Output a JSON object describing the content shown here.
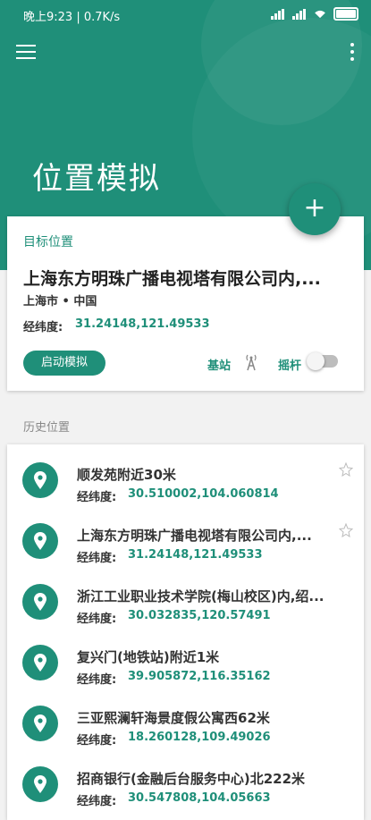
{
  "status_bar": {
    "time": "晚上9:23 | 0.7K/s"
  },
  "header": {
    "title": "位置模拟",
    "fab_label": "+"
  },
  "target": {
    "label": "目标位置",
    "name": "上海东方明珠广播电视塔有限公司内,...",
    "city": "上海市 • 中国",
    "coord_label": "经纬度:",
    "coord_value": "31.24148,121.49533",
    "start_button": "启动模拟",
    "base_station": "基站",
    "joystick": "摇杆",
    "joystick_enabled": false
  },
  "history": {
    "label": "历史位置",
    "coord_label": "经纬度:",
    "items": [
      {
        "name": "顺发苑附近30米",
        "coord": "30.510002,104.060814",
        "pinned": true
      },
      {
        "name": "上海东方明珠广播电视塔有限公司内,...",
        "coord": "31.24148,121.49533",
        "pinned": true
      },
      {
        "name": "浙江工业职业技术学院(梅山校区)内,绍...",
        "coord": "30.032835,120.57491",
        "pinned": false
      },
      {
        "name": "复兴门(地铁站)附近1米",
        "coord": "39.905872,116.35162",
        "pinned": false
      },
      {
        "name": "三亚熙澜轩海景度假公寓西62米",
        "coord": "18.260128,109.49026",
        "pinned": false
      },
      {
        "name": "招商银行(金融后台服务中心)北222米",
        "coord": "30.547808,104.05663",
        "pinned": false
      }
    ]
  },
  "colors": {
    "accent": "#1f8f79",
    "background": "#f2f2f2"
  }
}
